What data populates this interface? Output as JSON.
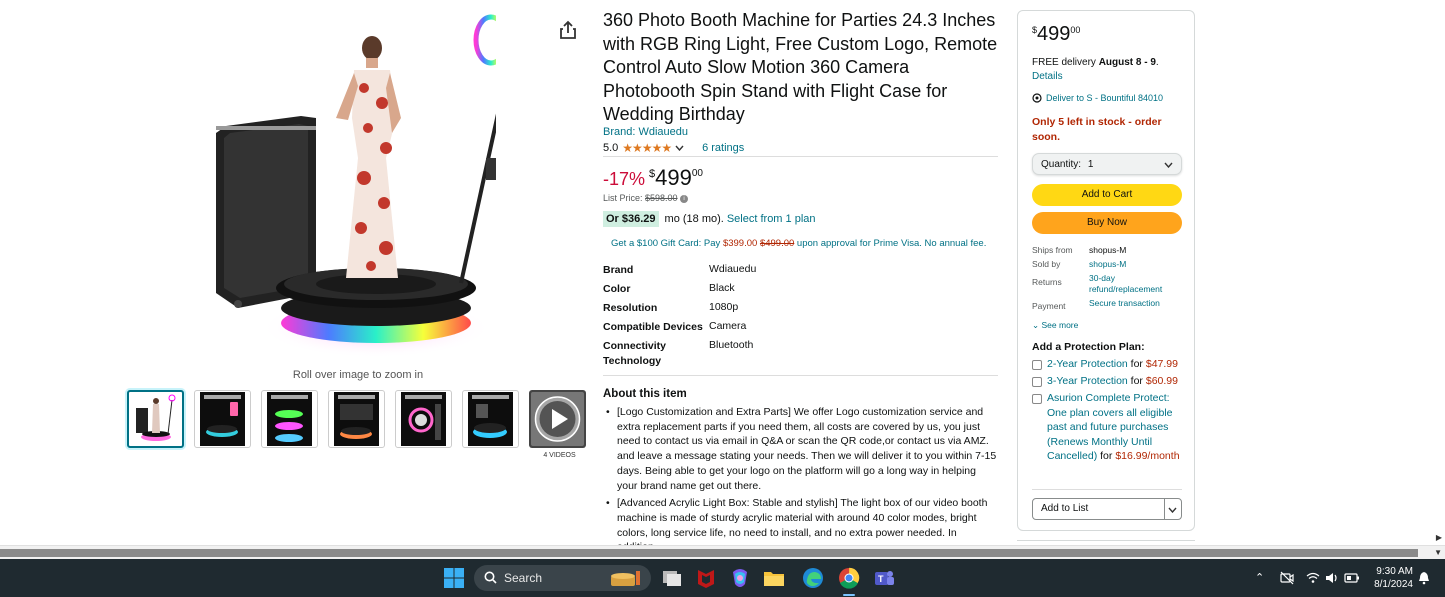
{
  "product": {
    "title": "360 Photo Booth Machine for Parties 24.3 Inches with RGB Ring Light, Free Custom Logo, Remote Control Auto Slow Motion 360 Camera Photobooth Spin Stand with Flight Case for Wedding Birthday",
    "brand": "Brand: Wdiauedu",
    "rating_value": "5.0",
    "stars": "★★★★★",
    "ratings_count": "6 ratings",
    "discount": "-17%",
    "price_symbol": "$",
    "price_whole": "499",
    "price_fraction": "00",
    "list_price_label": "List Price:",
    "list_price": "$598.00",
    "monthly_amount": "Or $36.29",
    "monthly_terms": "mo (18 mo).",
    "monthly_link": "Select from 1 plan",
    "giftcard_prefix": "Get a $100 Gift Card: Pay",
    "giftcard_pay": "$399.00",
    "giftcard_strike": "$499.00",
    "giftcard_suffix": "upon approval for Prime Visa. No annual fee.",
    "zoom_hint": "Roll over image to zoom in",
    "videos_label": "4 VIDEOS"
  },
  "specs": [
    {
      "key": "Brand",
      "value": "Wdiauedu"
    },
    {
      "key": "Color",
      "value": "Black"
    },
    {
      "key": "Resolution",
      "value": "1080p"
    },
    {
      "key": "Compatible Devices",
      "value": "Camera"
    },
    {
      "key": "Connectivity Technology",
      "value": "Bluetooth"
    }
  ],
  "about": {
    "heading": "About this item",
    "bullets": [
      "[Logo Customization and Extra Parts] We offer Logo customization service and extra replacement parts if you need them, all costs are covered by us, you just need to contact us via email in Q&A or scan the QR code,or contact us via AMZ. and leave a message stating your needs. Then we will deliver it to you within 7-15 days. Being able to get your logo on the platform will go a long way in helping your brand name get out there.",
      "[Advanced Acrylic Light Box: Stable and stylish] The light box of our video booth machine is made of sturdy acrylic material with around 40 color modes, bright colors, long service life, no need to install, and no extra power needed. In addition,"
    ]
  },
  "buybox": {
    "price_symbol": "$",
    "price_whole": "499",
    "price_fraction": "00",
    "delivery_prefix": "FREE delivery",
    "delivery_dates": "August 8 - 9",
    "delivery_period": ".",
    "details_link": "Details",
    "deliver_to": "Deliver to S - Bountiful 84010",
    "stock": "Only 5 left in stock - order soon.",
    "quantity_label": "Quantity:",
    "quantity_value": "1",
    "add_to_cart": "Add to Cart",
    "buy_now": "Buy Now",
    "meta": [
      {
        "key": "Ships from",
        "value": "shopus-M"
      },
      {
        "key": "Sold by",
        "value": "shopus-M"
      },
      {
        "key": "Returns",
        "value": "30-day refund/replacement"
      },
      {
        "key": "Payment",
        "value": "Secure transaction"
      }
    ],
    "see_more": "See more",
    "protection_heading": "Add a Protection Plan:",
    "protection_options": [
      {
        "label": "2-Year Protection",
        "for": "for",
        "price": "$47.99"
      },
      {
        "label": "3-Year Protection",
        "for": "for",
        "price": "$60.99"
      },
      {
        "label": "Asurion Complete Protect: One plan covers all eligible past and future purchases (Renews Monthly Until Cancelled)",
        "for": "for",
        "price": "$16.99/month"
      }
    ],
    "add_to_list": "Add to List"
  },
  "taskbar": {
    "search_label": "Search",
    "time": "9:30 AM",
    "date": "8/1/2024"
  },
  "colors": {
    "link": "#007185",
    "price_red": "#b12704",
    "discount_red": "#cc0c39",
    "add_to_cart": "#ffd814",
    "buy_now": "#ffa41c",
    "star": "#de7921",
    "taskbar": "#1f2a30"
  }
}
